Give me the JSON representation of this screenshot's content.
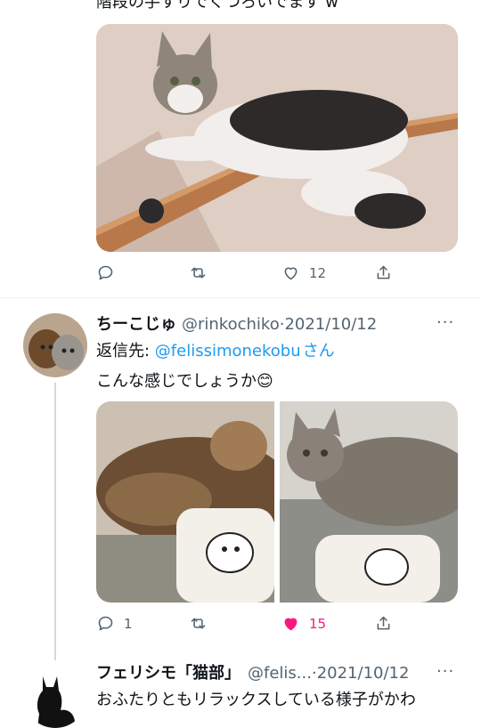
{
  "tweet_top": {
    "text": "階段の手すりでくつろいでます w",
    "actions": {
      "reply": "",
      "retweet": "",
      "like": "12",
      "share": ""
    }
  },
  "tweet_reply": {
    "display_name": "ちーこじゅ",
    "handle": "@rinkochiko",
    "separator": "·",
    "date": "2021/10/12",
    "more": "···",
    "reply_to_prefix": "返信先: ",
    "reply_to_handle": "@felissimonekobu",
    "reply_to_suffix": "さん",
    "text": "こんな感じでしょうか",
    "emoji": "😊",
    "actions": {
      "reply": "1",
      "retweet": "",
      "like": "15",
      "share": ""
    }
  },
  "tweet_next": {
    "display_name": "フェリシモ「猫部」",
    "handle": "@felis...",
    "separator": "·",
    "date": "2021/10/12",
    "more": "···",
    "text": "おふたりともリラックスしている様子がかわ"
  },
  "colors": {
    "accent": "#1d9bf0",
    "like_active": "#f91880",
    "muted": "#536471"
  }
}
